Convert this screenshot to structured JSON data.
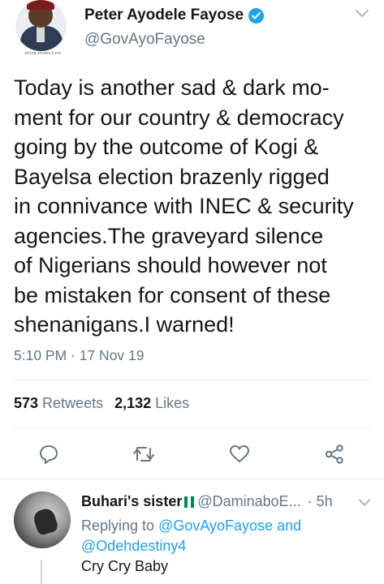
{
  "tweet": {
    "author": {
      "name": "Peter Ayodele Fayose",
      "handle": "@GovAyoFayose",
      "verified": true,
      "avatar_caption": "PETER AYODELE FAY"
    },
    "text": "Today is another sad & dark  mo-\nment for our country & democracy\ngoing by the outcome of Kogi &\nBayelsa election brazenly rigged\nin connivance with INEC & security\nagencies.The graveyard silence\nof Nigerians should however not\nbe mistaken for consent of these\nshenanigans.I warned!",
    "timestamp": "5:10 PM · 17 Nov 19",
    "stats": {
      "retweets_count": "573",
      "retweets_label": "Retweets",
      "likes_count": "2,132",
      "likes_label": "Likes"
    },
    "actions": [
      "reply-icon",
      "retweet-icon",
      "like-icon",
      "share-icon"
    ]
  },
  "reply": {
    "name": "Buhari's sister",
    "flag": [
      "#008751",
      "#ffffff",
      "#008751"
    ],
    "handle": "@DaminaboE...",
    "time": "· 5h",
    "replying_prefix": "Replying to",
    "mention_1": "@GovAyoFayose",
    "conjunction": "and",
    "mention_2": "@Odehdestiny4",
    "text": "Cry Cry Baby"
  },
  "colors": {
    "accent": "#1da1f2",
    "text": "#14171a",
    "muted": "#657786",
    "divider": "#e1e8ed"
  }
}
